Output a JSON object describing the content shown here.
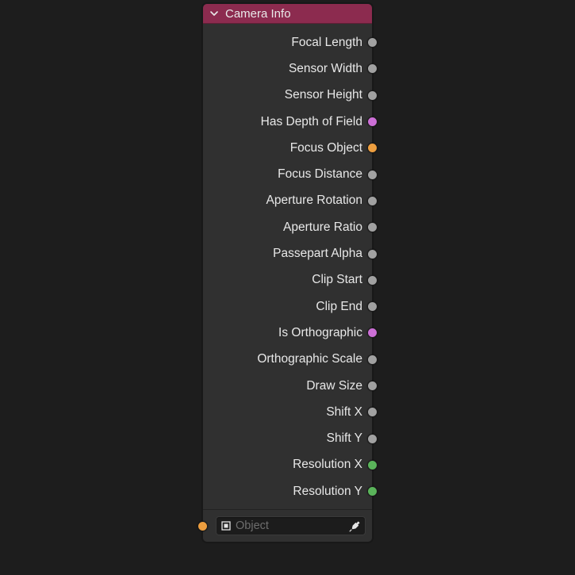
{
  "node": {
    "title": "Camera Info",
    "outputs": [
      {
        "label": "Focal Length",
        "color": "#a1a1a1"
      },
      {
        "label": "Sensor Width",
        "color": "#a1a1a1"
      },
      {
        "label": "Sensor Height",
        "color": "#a1a1a1"
      },
      {
        "label": "Has Depth of Field",
        "color": "#cc6fd6"
      },
      {
        "label": "Focus Object",
        "color": "#ed9e3f"
      },
      {
        "label": "Focus Distance",
        "color": "#a1a1a1"
      },
      {
        "label": "Aperture Rotation",
        "color": "#a1a1a1"
      },
      {
        "label": "Aperture Ratio",
        "color": "#a1a1a1"
      },
      {
        "label": "Passepart Alpha",
        "color": "#a1a1a1"
      },
      {
        "label": "Clip Start",
        "color": "#a1a1a1"
      },
      {
        "label": "Clip End",
        "color": "#a1a1a1"
      },
      {
        "label": "Is Orthographic",
        "color": "#cc6fd6"
      },
      {
        "label": "Orthographic Scale",
        "color": "#a1a1a1"
      },
      {
        "label": "Draw Size",
        "color": "#a1a1a1"
      },
      {
        "label": "Shift X",
        "color": "#a1a1a1"
      },
      {
        "label": "Shift Y",
        "color": "#a1a1a1"
      },
      {
        "label": "Resolution X",
        "color": "#5ab45a"
      },
      {
        "label": "Resolution Y",
        "color": "#5ab45a"
      }
    ],
    "input": {
      "placeholder": "Object",
      "socket_color": "#ed9e3f"
    }
  }
}
